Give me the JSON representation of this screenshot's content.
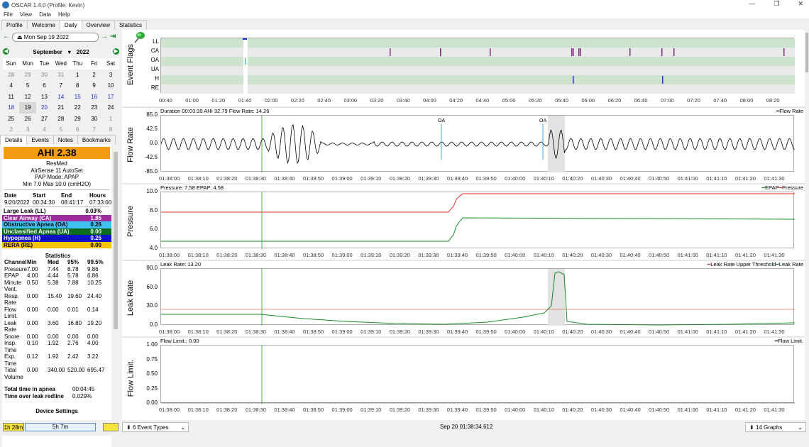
{
  "window": {
    "title": "OSCAR 1.4.0 (Profile: Kevin)",
    "controls": [
      "—",
      "❐",
      "✕"
    ]
  },
  "menu": [
    "File",
    "View",
    "Data",
    "Help"
  ],
  "tabs": [
    "Profile",
    "Welcome",
    "Daily",
    "Overview",
    "Statistics"
  ],
  "active_tab": "Daily",
  "date_nav": {
    "date": "Mon Sep 19 2022"
  },
  "calendar": {
    "month": "September",
    "year": "2022",
    "dow": [
      "Sun",
      "Mon",
      "Tue",
      "Wed",
      "Thu",
      "Fri",
      "Sat"
    ],
    "weeks": [
      [
        "28",
        "29",
        "30",
        "31",
        "1",
        "2",
        "3"
      ],
      [
        "4",
        "5",
        "6",
        "7",
        "8",
        "9",
        "10"
      ],
      [
        "11",
        "12",
        "13",
        "14",
        "15",
        "16",
        "17"
      ],
      [
        "18",
        "19",
        "20",
        "21",
        "22",
        "23",
        "24"
      ],
      [
        "25",
        "26",
        "27",
        "28",
        "29",
        "30",
        "1"
      ],
      [
        "2",
        "3",
        "4",
        "5",
        "6",
        "7",
        "8"
      ]
    ],
    "selected": "19"
  },
  "subtabs": [
    "Details",
    "Events",
    "Notes",
    "Bookmarks"
  ],
  "details": {
    "ahi": "AHI 2.38",
    "machine_brand": "ResMed",
    "machine_model": "AirSense 11 AutoSet",
    "pap_mode": "PAP Mode: APAP",
    "pressure_range": "Min 7.0 Max 10.0 (cmH2O)",
    "session_headers": [
      "Date",
      "Start",
      "End",
      "Hours"
    ],
    "session_values": [
      "9/20/2022",
      "00:34:30",
      "08:41:17",
      "07:33:00"
    ],
    "events": [
      {
        "name": "Large Leak (LL)",
        "value": "0.03%",
        "color": "#ffffff",
        "text": "#000000"
      },
      {
        "name": "Clear Airway (CA)",
        "value": "1.85",
        "color": "#9b2a9b",
        "text": "#ffffff"
      },
      {
        "name": "Obstructive Apnea (OA)",
        "value": "0.26",
        "color": "#40c0f0",
        "text": "#000000"
      },
      {
        "name": "Unclassified Apnea (UA)",
        "value": "0.00",
        "color": "#0a6b1e",
        "text": "#ffffff"
      },
      {
        "name": "Hypopnea (H)",
        "value": "0.26",
        "color": "#1010c8",
        "text": "#ffffff"
      },
      {
        "name": "RERA (RE)",
        "value": "0.00",
        "color": "#f5c400",
        "text": "#000000"
      }
    ],
    "stats_title": "Statistics",
    "stats_headers": [
      "Channel",
      "Min",
      "Med",
      "95%",
      "99.5%"
    ],
    "stats_rows": [
      [
        "Pressure",
        "7.00",
        "7.44",
        "8.78",
        "9.86"
      ],
      [
        "EPAP",
        "4.00",
        "4.44",
        "5.78",
        "6.86"
      ],
      [
        "Minute Vent.",
        "0.50",
        "5.38",
        "7.88",
        "10.25"
      ],
      [
        "Resp. Rate",
        "0.00",
        "15.40",
        "19.60",
        "24.40"
      ],
      [
        "Flow Limit.",
        "0.00",
        "0.00",
        "0.01",
        "0.14"
      ],
      [
        "Leak Rate",
        "0.00",
        "3.60",
        "16.80",
        "19.20"
      ],
      [
        "Snore",
        "0.00",
        "0.00",
        "0.00",
        "0.00"
      ],
      [
        "Insp. Time",
        "0.10",
        "1.92",
        "2.76",
        "4.00"
      ],
      [
        "Exp. Time",
        "0.12",
        "1.92",
        "2.42",
        "3.22"
      ],
      [
        "Tidal Volume",
        "0.00",
        "340.00",
        "520.00",
        "695.47"
      ]
    ],
    "total_apnea_label": "Total time in apnea",
    "total_apnea_value": "00:04:45",
    "leak_redline_label": "Time over leak redline",
    "leak_redline_value": "0.029%",
    "device_settings": "Device Settings"
  },
  "event_flags": {
    "title": "Event Flags",
    "rows": [
      "LL",
      "CA",
      "OA",
      "UA",
      "H",
      "RE"
    ],
    "ticks": [
      "00:40",
      "01:00",
      "01:20",
      "01:40",
      "02:00",
      "02:20",
      "02:40",
      "03:00",
      "03:20",
      "03:40",
      "04:00",
      "04:20",
      "04:40",
      "05:00",
      "05:20",
      "05:40",
      "06:00",
      "06:20",
      "06:40",
      "07:00",
      "07:20",
      "07:40",
      "08:00",
      "08:20"
    ]
  },
  "time_ticks": [
    "01:38:00",
    "01:38:10",
    "01:38:20",
    "01:38:30",
    "01:38:40",
    "01:38:50",
    "01:39:00",
    "01:39:10",
    "01:39:20",
    "01:39:30",
    "01:39:40",
    "01:39:50",
    "01:40:00",
    "01:40:10",
    "01:40:20",
    "01:40:30",
    "01:40:40",
    "01:40:50",
    "01:41:00",
    "01:41:10",
    "01:41:20",
    "01:41:30"
  ],
  "flow_rate": {
    "ylabel": "Flow Rate",
    "header": "Duration 00:03:39 AHI 32.79 Flow Rate: 14.26",
    "legend": "Flow Rate",
    "yticks": [
      "85.0",
      "42.5",
      "0.0",
      "-42.5",
      "-85.0"
    ],
    "annotations": [
      "OA",
      "OA"
    ]
  },
  "pressure": {
    "ylabel": "Pressure",
    "header": "Pressure: 7.58 EPAP: 4.58",
    "legend_epap": "EPAP",
    "legend_pressure": "Pressure",
    "yticks": [
      "10.0",
      "8.0",
      "6.0",
      "4.0"
    ],
    "colors": {
      "epap": "#1a8a2a",
      "pressure": "#e03030"
    }
  },
  "leak_rate": {
    "ylabel": "Leak Rate",
    "header": "Leak Rate: 13.20",
    "legend_threshold": "Leak Rate Upper Threshold",
    "legend_leak": "Leak Rate",
    "yticks": [
      "90.0",
      "60.0",
      "30.0",
      "0.0"
    ]
  },
  "flow_limit": {
    "ylabel": "Flow Limit.",
    "header": "Flow Limit.: 0.00",
    "legend": "Flow Limit.",
    "yticks": [
      "1.00",
      "0.75",
      "0.50",
      "0.25",
      "0.00"
    ]
  },
  "bottom": {
    "duration_short": "1h 28m",
    "duration_long": "5h 7m",
    "event_types": "6 Event Types",
    "timestamp": "Sep 20 01:38:34.612",
    "graphs": "14 Graphs"
  }
}
